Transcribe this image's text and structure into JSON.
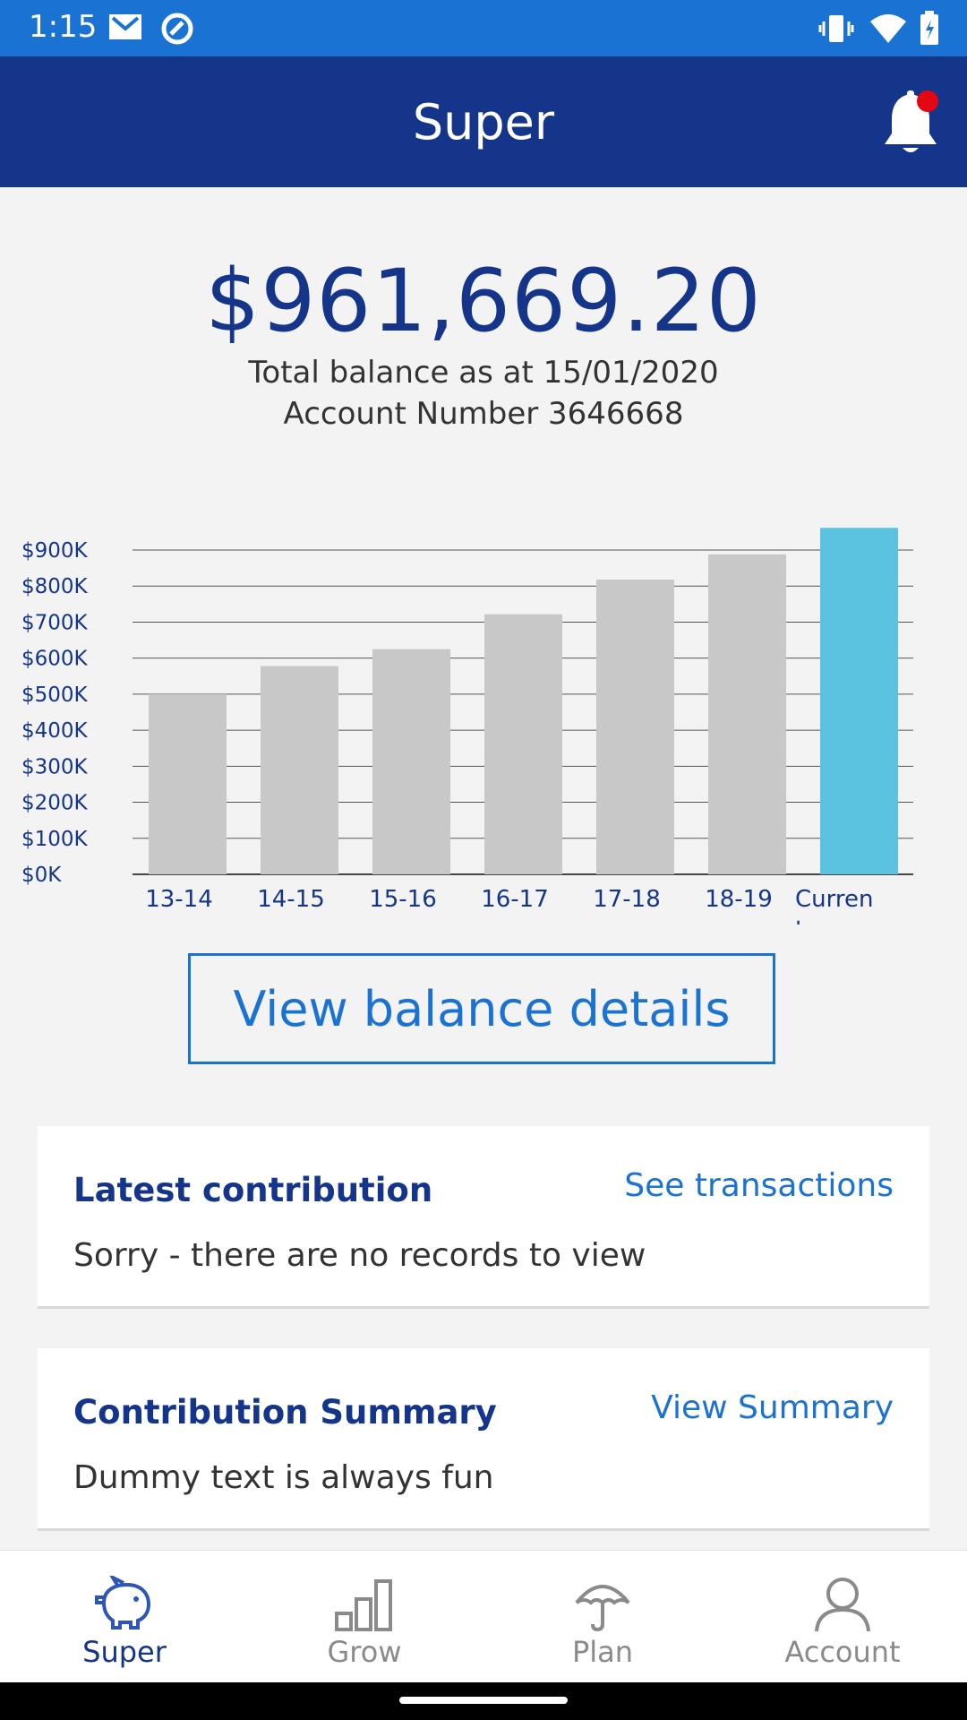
{
  "status_bar": {
    "time": "1:15",
    "icons": [
      "gmail-icon",
      "sync-icon",
      "vibrate-icon",
      "wifi-icon",
      "battery-icon"
    ]
  },
  "app_bar": {
    "title": "Super",
    "notification_icon": "bell-icon",
    "has_unread": true
  },
  "balance": {
    "amount": "$961,669.20",
    "as_at": "Total balance as at 15/01/2020",
    "account": "Account Number 3646668"
  },
  "chart_data": {
    "type": "bar",
    "categories": [
      "13-14",
      "14-15",
      "15-16",
      "16-17",
      "17-18",
      "18-19",
      "Current"
    ],
    "values": [
      500000,
      578000,
      625000,
      722000,
      818000,
      888000,
      961669.2
    ],
    "y_ticks": [
      "$0K",
      "$100K",
      "$200K",
      "$300K",
      "$400K",
      "$500K",
      "$600K",
      "$700K",
      "$800K",
      "$900K"
    ],
    "ylim": [
      0,
      900000
    ],
    "grid": true,
    "colors": {
      "past": "#c8c8c8",
      "current": "#5bc3e0",
      "axis_text": "#14358a"
    }
  },
  "view_balance_button": "View balance details",
  "cards": [
    {
      "title": "Latest contribution",
      "link": "See transactions",
      "text": "Sorry - there are no records to view"
    },
    {
      "title": "Contribution Summary",
      "link": "View Summary",
      "text": "Dummy text is always fun"
    }
  ],
  "bottom_nav": [
    {
      "label": "Super",
      "icon": "piggy-bank-icon",
      "active": true
    },
    {
      "label": "Grow",
      "icon": "bar-chart-icon",
      "active": false
    },
    {
      "label": "Plan",
      "icon": "umbrella-icon",
      "active": false
    },
    {
      "label": "Account",
      "icon": "person-icon",
      "active": false
    }
  ],
  "colors": {
    "status_bar": "#1a73d2",
    "app_bar": "#14358a",
    "accent": "#1a73d2",
    "notification_dot": "#e30613"
  }
}
